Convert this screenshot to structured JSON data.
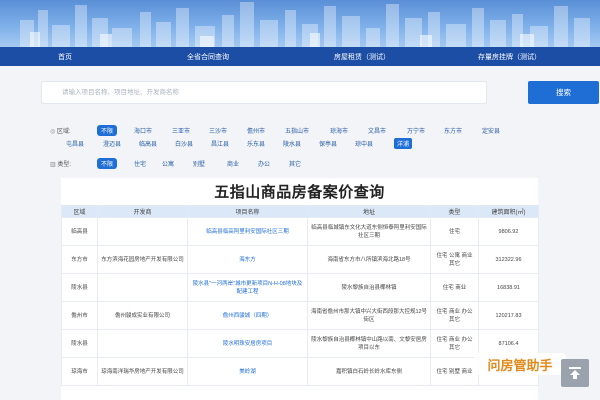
{
  "nav": {
    "items": [
      "首页",
      "全省合同查询",
      "房屋租赁（测试）",
      "存量房挂牌（测试）"
    ]
  },
  "search": {
    "placeholder": "请输入项目名称、项目地址、开发商名称",
    "button_label": "搜索"
  },
  "filters": {
    "region_label": "区域:",
    "regions_row1": [
      "不限",
      "海口市",
      "三亚市",
      "三沙市",
      "儋州市",
      "五指山市",
      "琼海市",
      "文昌市",
      "万宁市",
      "东方市",
      "定安县"
    ],
    "regions_row2": [
      "屯昌县",
      "澄迈县",
      "临高县",
      "白沙县",
      "昌江县",
      "乐东县",
      "陵水县",
      "保亭县",
      "琼中县",
      "洋浦"
    ],
    "type_label": "类型:",
    "types": [
      "不限",
      "住宅",
      "公寓",
      "别墅",
      "商业",
      "办公",
      "其它"
    ]
  },
  "page": {
    "title": "五指山商品房备案价查询"
  },
  "table": {
    "headers": [
      "区域",
      "开发商",
      "项目名称",
      "地址",
      "类型",
      "建筑面积(㎡)"
    ],
    "rows": [
      [
        "临高县",
        "",
        "临高县临高阿里利安国际社区三期",
        "临高县临城镇东文化大道东侧恒泰阿里利安国际社区三期",
        "住宅",
        "9806.92"
      ],
      [
        "东方市",
        "东方滨海花园房地产开发有限公司",
        "海东方",
        "海南省东方市八所镇滨海北路18号",
        "住宅 公寓 商业 其它",
        "312322.96"
      ],
      [
        "陵水县",
        "",
        "陵水县\"一河两岸\"城市更新项目N-H-08地块及配建工程",
        "陵水黎族自治县椰林镇",
        "住宅 商业",
        "16838.91"
      ],
      [
        "儋州市",
        "儋州骏成实业有限公司",
        "儋州西骏城（四期）",
        "海南省儋州市那大镇中兴大街西段那大控规12号街区",
        "住宅 商业 办公 其它",
        "120217.83"
      ],
      [
        "陵水县",
        "",
        "陵水明珠安居房项目",
        "陵水黎族自治县椰林镇中山路以南、文黎安居房项目以东",
        "住宅 商业 办公 其它",
        "87106.4"
      ],
      [
        "琼海市",
        "琼海南洋瑞华房地产开发有限公司",
        "美岭湖",
        "嘉积镇白石岭长岭水库东侧",
        "住宅 别墅 商业",
        "230782.6"
      ]
    ]
  },
  "watermark": {
    "text": "问房管助手"
  },
  "colors": {
    "nav": "#1d4ea6",
    "accent": "#1f6ed6",
    "header_bg": "#dbe8f7"
  }
}
